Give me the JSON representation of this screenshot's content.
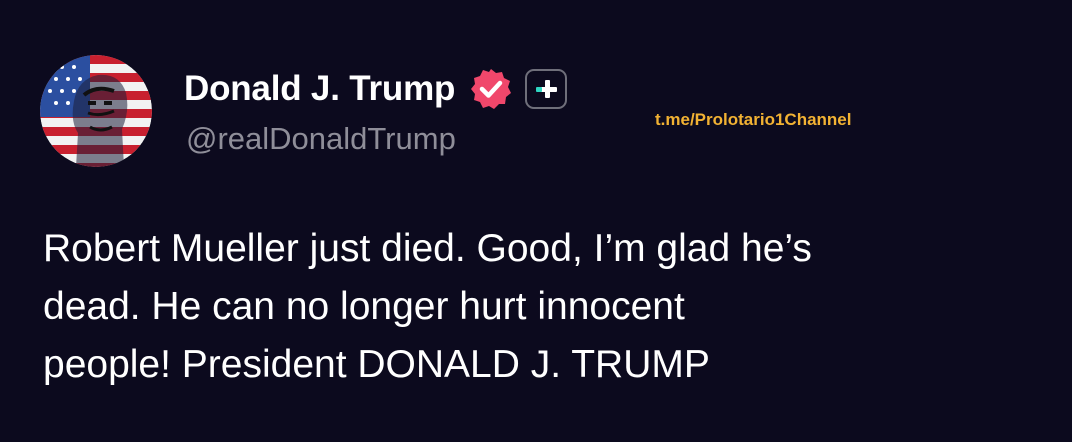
{
  "post": {
    "author": {
      "display_name": "Donald J. Trump",
      "handle": "@realDonaldTrump",
      "avatar_icon": "flag-portrait-avatar",
      "verified_icon": "verified-check-icon",
      "verified_color": "#f0476b",
      "badge_icon": "plus-badge-icon",
      "badge_accent": "#2fd6c2"
    },
    "watermark": "t.me/Prolotario1Channel",
    "text_lines": [
      "Robert Mueller just died. Good, I’m glad he’s",
      "dead. He can no longer hurt innocent",
      "people! President DONALD J. TRUMP"
    ]
  },
  "colors": {
    "background": "#0c0a1e",
    "text": "#ffffff",
    "handle": "#8f8e99",
    "watermark": "#f2b233"
  }
}
